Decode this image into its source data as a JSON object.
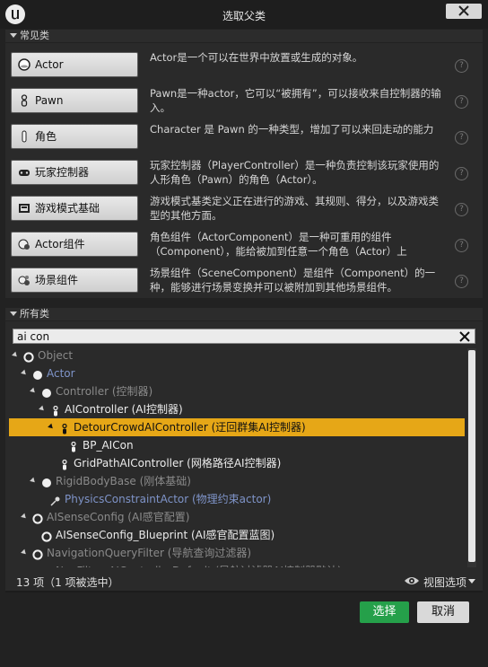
{
  "window": {
    "title": "选取父类"
  },
  "common_section": {
    "header": "常见类",
    "items": [
      {
        "label": "Actor",
        "icon": "actor-icon",
        "desc": "Actor是一个可以在世界中放置或生成的对象。"
      },
      {
        "label": "Pawn",
        "icon": "pawn-icon",
        "desc": "Pawn是一种actor，它可以“被拥有”，可以接收来自控制器的输入。"
      },
      {
        "label": "角色",
        "icon": "character-icon",
        "desc": "Character 是 Pawn 的一种类型，增加了可以来回走动的能力"
      },
      {
        "label": "玩家控制器",
        "icon": "player-controller-icon",
        "desc": "玩家控制器（PlayerController）是一种负责控制该玩家使用的人形角色（Pawn）的角色（Actor）。"
      },
      {
        "label": "游戏模式基础",
        "icon": "game-mode-icon",
        "desc": "游戏模式基类定义正在进行的游戏、其规则、得分，以及游戏类型的其他方面。"
      },
      {
        "label": "Actor组件",
        "icon": "actor-component-icon",
        "desc": "角色组件（ActorComponent）是一种可重用的组件（Component），能给被加到任意一个角色（Actor）上"
      },
      {
        "label": "场景组件",
        "icon": "scene-component-icon",
        "desc": "场景组件（SceneComponent）是组件（Component）的一种，能够进行场景变换并可以被附加到其他场景组件。"
      }
    ]
  },
  "all_section": {
    "header": "所有类",
    "search_value": "ai con",
    "tree": [
      {
        "label": "Object",
        "style": "dim",
        "icon": "ring-icon",
        "expander": true,
        "indent": 0
      },
      {
        "label": "Actor",
        "style": "blue",
        "icon": "sphere-icon",
        "expander": true,
        "indent": 1
      },
      {
        "label": "Controller (控制器)",
        "style": "dim",
        "icon": "sphere-icon",
        "expander": true,
        "indent": 2
      },
      {
        "label": "AIController (AI控制器)",
        "style": "white",
        "icon": "pawn-small-icon",
        "expander": true,
        "indent": 3
      },
      {
        "label": "DetourCrowdAIController (迂回群集AI控制器)",
        "style": "dark",
        "icon": "pawn-small-icon",
        "expander": true,
        "indent": 4,
        "selected": true
      },
      {
        "label": "BP_AICon",
        "style": "white",
        "icon": "pawn-small-icon",
        "expander": false,
        "indent": 5
      },
      {
        "label": "GridPathAIController (网格路径AI控制器)",
        "style": "white",
        "icon": "pawn-small-icon",
        "expander": false,
        "indent": 4
      },
      {
        "label": "RigidBodyBase (刚体基础)",
        "style": "dim",
        "icon": "sphere-icon",
        "expander": true,
        "indent": 2
      },
      {
        "label": "PhysicsConstraintActor (物理约束actor)",
        "style": "blue",
        "icon": "constraint-icon",
        "expander": false,
        "indent": 3
      },
      {
        "label": "AISenseConfig (AI感官配置)",
        "style": "dim",
        "icon": "ring-icon",
        "expander": true,
        "indent": 1
      },
      {
        "label": "AISenseConfig_Blueprint (AI感官配置蓝图)",
        "style": "white",
        "icon": "ring-icon",
        "expander": false,
        "indent": 2
      },
      {
        "label": "NavigationQueryFilter (导航查询过滤器)",
        "style": "dim",
        "icon": "ring-icon",
        "expander": true,
        "indent": 1
      },
      {
        "label": "NavFilter_AIControllerDefault (导航过滤器AI控制器默认)",
        "style": "dim",
        "icon": "ring-icon",
        "expander": false,
        "indent": 2
      }
    ],
    "status": "13 项（1 项被选中）",
    "view_options": "视图选项"
  },
  "footer": {
    "select_label": "选择",
    "cancel_label": "取消"
  },
  "colors": {
    "selection": "#e6a717",
    "select_button": "#25a04a",
    "blue_text": "#7f94c9"
  }
}
